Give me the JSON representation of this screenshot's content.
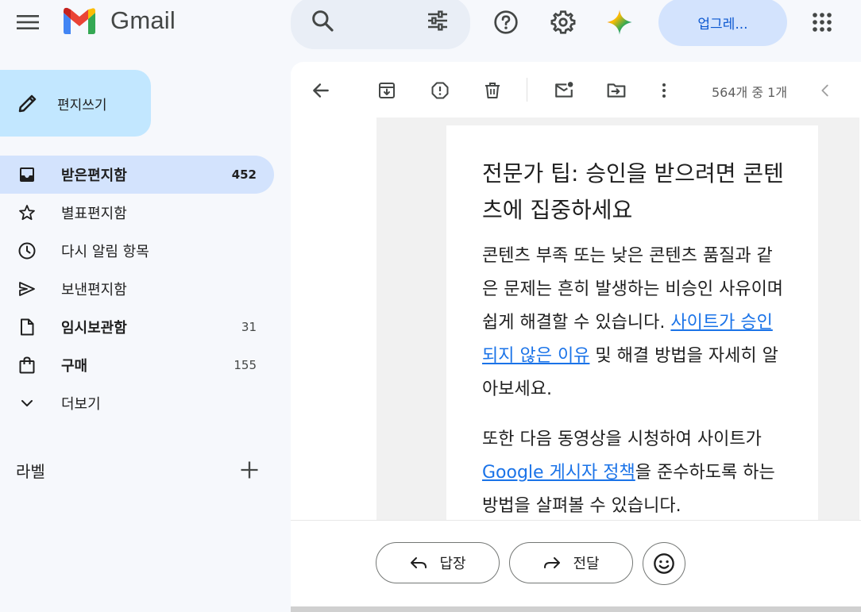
{
  "app": {
    "logo_text": "Gmail"
  },
  "header": {
    "upgrade_label": "업그레..."
  },
  "compose": {
    "label": "편지쓰기"
  },
  "sidebar": {
    "items": [
      {
        "label": "받은편지함",
        "count": "452",
        "bold": true,
        "active": true,
        "icon": "inbox-icon"
      },
      {
        "label": "별표편지함",
        "count": "",
        "bold": false,
        "active": false,
        "icon": "star-icon"
      },
      {
        "label": "다시 알림 항목",
        "count": "",
        "bold": false,
        "active": false,
        "icon": "clock-icon"
      },
      {
        "label": "보낸편지함",
        "count": "",
        "bold": false,
        "active": false,
        "icon": "send-icon"
      },
      {
        "label": "임시보관함",
        "count": "31",
        "bold": true,
        "active": false,
        "icon": "draft-icon"
      },
      {
        "label": "구매",
        "count": "155",
        "bold": true,
        "active": false,
        "icon": "shopping-bag-icon"
      },
      {
        "label": "더보기",
        "count": "",
        "bold": false,
        "active": false,
        "icon": "chevron-down-icon"
      }
    ],
    "labels_header": "라벨"
  },
  "toolbar": {
    "pager_text": "564개 중 1개"
  },
  "message": {
    "headline": "전문가 팁: 승인을 받으려면 콘텐츠에 집중하세요",
    "p1_text1": "콘텐츠 부족 또는 낮은 콘텐츠 품질과 같은 문제는 흔히 발생하는 비승인 사유이며 쉽게 해결할 수 있습니다. ",
    "p1_link": "사이트가 승인되지 않은 이유",
    "p1_text2": " 및 해결 방법을 자세히 알아보세요.",
    "p2_text1": "또한 다음 동영상을 시청하여 사이트가 ",
    "p2_link": "Google 게시자 정책",
    "p2_text2": "을 준수하도록 하는 방법을 살펴볼 수 있습니다."
  },
  "actions": {
    "reply_label": "답장",
    "forward_label": "전달"
  },
  "colors": {
    "accent": "#0b57d0",
    "link": "#1a73e8",
    "compose_bg": "#c2e7ff",
    "active_bg": "#d3e3fd"
  }
}
